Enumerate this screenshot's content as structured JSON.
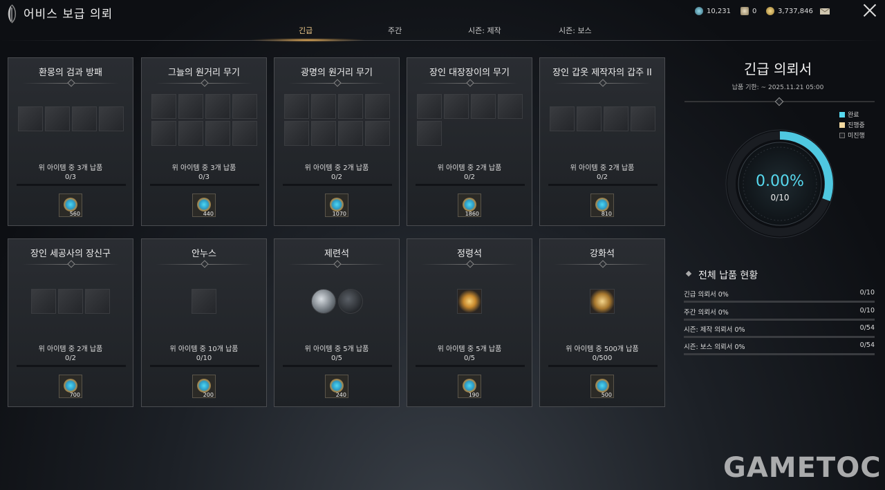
{
  "window": {
    "title": "어비스 보급 의뢰"
  },
  "currency": [
    {
      "icon": "gem-icon",
      "value": "10,231"
    },
    {
      "icon": "scroll-icon",
      "value": "0"
    },
    {
      "icon": "gold-coin-icon",
      "value": "3,737,846"
    }
  ],
  "tabs": [
    {
      "label": "긴급",
      "active": true
    },
    {
      "label": "주간",
      "active": false
    },
    {
      "label": "시즌: 제작",
      "active": false
    },
    {
      "label": "시즌: 보스",
      "active": false
    }
  ],
  "cards": [
    {
      "title": "환몽의 검과 방패",
      "requirement": "위 아이템 중 3개 납품",
      "progress": "0/3",
      "reward": "560",
      "item_count": 4,
      "item_icon": "weapon-icon"
    },
    {
      "title": "그늘의 원거리 무기",
      "requirement": "위 아이템 중 3개 납품",
      "progress": "0/3",
      "reward": "440",
      "item_count": 8,
      "item_icon": "weapon-icon"
    },
    {
      "title": "광명의 원거리 무기",
      "requirement": "위 아이템 중 2개 납품",
      "progress": "0/2",
      "reward": "1070",
      "item_count": 8,
      "item_icon": "weapon-icon"
    },
    {
      "title": "장인 대장장이의 무기",
      "requirement": "위 아이템 중 2개 납품",
      "progress": "0/2",
      "reward": "1860",
      "item_count": 5,
      "item_icon": "weapon-icon"
    },
    {
      "title": "장인 갑옷 제작자의 갑주 II",
      "requirement": "위 아이템 중 2개 납품",
      "progress": "0/2",
      "reward": "810",
      "item_count": 4,
      "item_icon": "armor-icon"
    },
    {
      "title": "장인 세공사의 장신구",
      "requirement": "위 아이템 중 2개 납품",
      "progress": "0/2",
      "reward": "700",
      "item_count": 3,
      "item_icon": "accessory-icon"
    },
    {
      "title": "안누스",
      "requirement": "위 아이템 중 10개 납품",
      "progress": "0/10",
      "reward": "200",
      "item_count": 1,
      "item_icon": "material-icon"
    },
    {
      "title": "제련석",
      "requirement": "위 아이템 중 5개 납품",
      "progress": "0/5",
      "reward": "240",
      "item_count": 2,
      "item_icon": "refining-stone-icon"
    },
    {
      "title": "정령석",
      "requirement": "위 아이템 중 5개 납품",
      "progress": "0/5",
      "reward": "190",
      "item_count": 1,
      "item_icon": "spirit-stone-icon"
    },
    {
      "title": "강화석",
      "requirement": "위 아이템 중 500개 납품",
      "progress": "0/500",
      "reward": "500",
      "item_count": 1,
      "item_icon": "enhance-stone-icon"
    }
  ],
  "panel": {
    "title": "긴급 의뢰서",
    "deadline": "납품 기한: ~ 2025.11.21 05:00",
    "legend": [
      {
        "label": "완료",
        "color": "#57d9ef"
      },
      {
        "label": "진행중",
        "color": "#f3d9a0"
      },
      {
        "label": "미진행",
        "color": "#1a1c20"
      }
    ],
    "percent": "0.00%",
    "count": "0/10",
    "overall_title": "전체 납품 현황",
    "status": [
      {
        "label": "긴급 의뢰서 0%",
        "value": "0/10"
      },
      {
        "label": "주간 의뢰서 0%",
        "value": "0/10"
      },
      {
        "label": "시즌: 제작 의뢰서 0%",
        "value": "0/54"
      },
      {
        "label": "시즌: 보스 의뢰서 0%",
        "value": "0/54"
      }
    ]
  },
  "watermark": "GAMETOC",
  "colors": {
    "accent": "#57d9ef",
    "tab_active": "#f0c98a"
  }
}
